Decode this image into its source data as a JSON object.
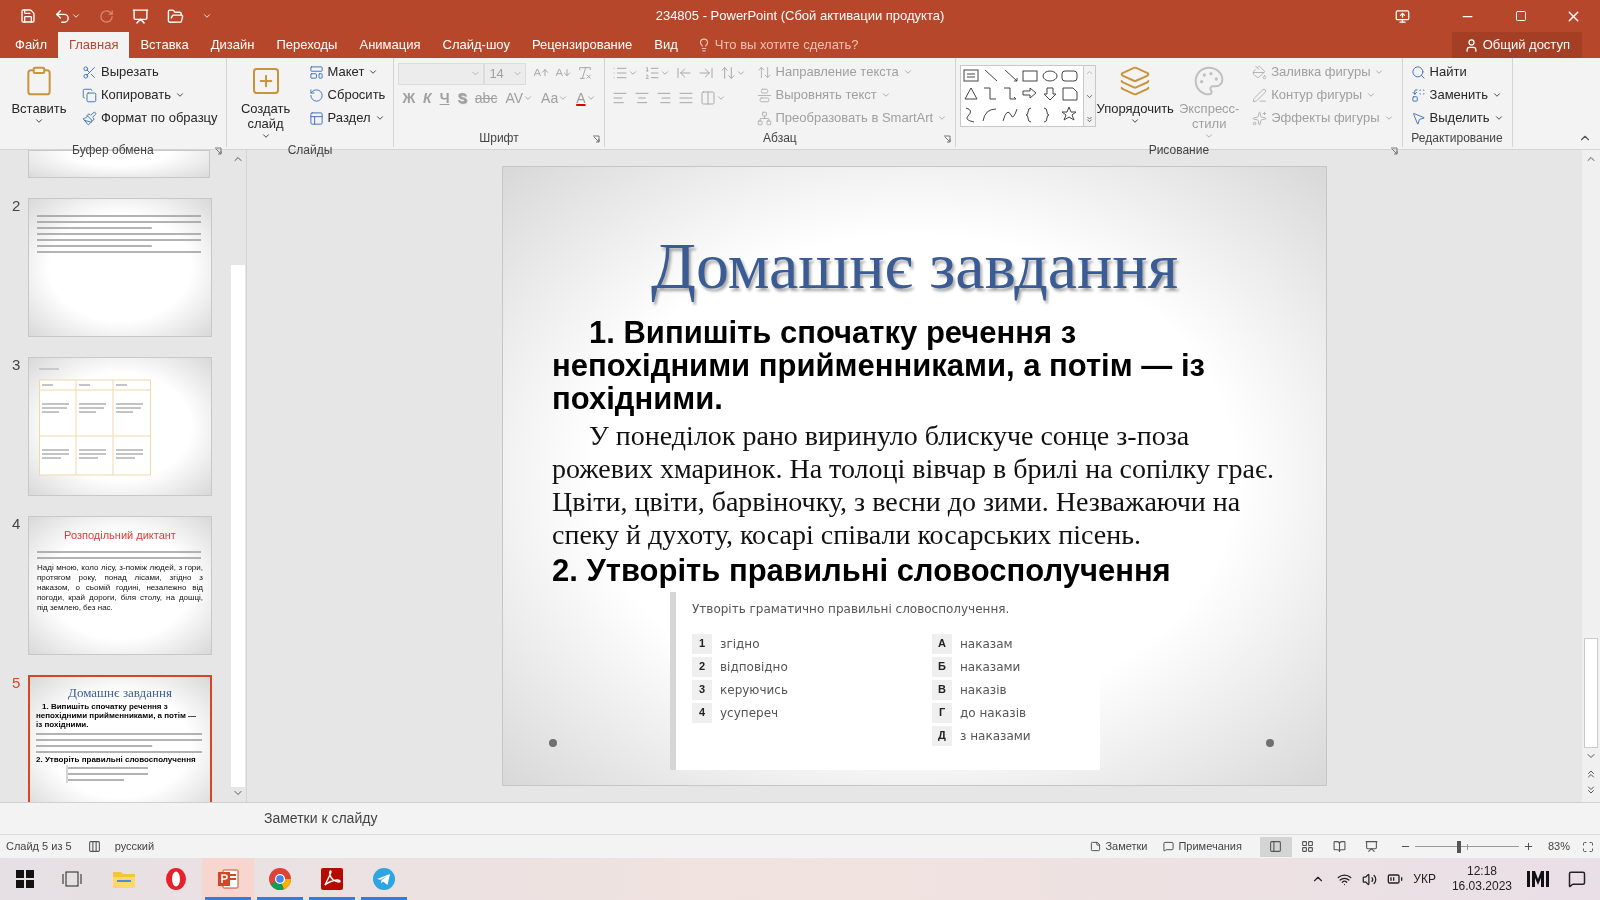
{
  "window": {
    "title": "234805 - PowerPoint (Сбой активации продукта)"
  },
  "menu_tabs": [
    {
      "label": "Файл",
      "selected": false
    },
    {
      "label": "Главная",
      "selected": true
    },
    {
      "label": "Вставка",
      "selected": false
    },
    {
      "label": "Дизайн",
      "selected": false
    },
    {
      "label": "Переходы",
      "selected": false
    },
    {
      "label": "Анимация",
      "selected": false
    },
    {
      "label": "Слайд-шоу",
      "selected": false
    },
    {
      "label": "Рецензирование",
      "selected": false
    },
    {
      "label": "Вид",
      "selected": false
    }
  ],
  "tell_me": {
    "placeholder": "Что вы хотите сделать?"
  },
  "share_button": "Общий доступ",
  "ribbon": {
    "groups": [
      {
        "title": "Буфер обмена",
        "launcher": true,
        "columns": [
          [
            [
              {
                "kind": "large",
                "label": "Вставить",
                "caret": true,
                "disabled": false
              }
            ]
          ],
          [
            [
              {
                "kind": "small",
                "label": "Вырезать",
                "caret": false,
                "disabled": false
              }
            ],
            [
              {
                "kind": "small",
                "label": "Копировать",
                "caret": true,
                "disabled": false
              }
            ],
            [
              {
                "kind": "small",
                "label": "Формат по образцу",
                "caret": false,
                "disabled": false
              }
            ]
          ]
        ]
      },
      {
        "title": "Слайды",
        "launcher": false,
        "columns": [
          [
            [
              {
                "kind": "large",
                "label": "Создать слайд",
                "caret": true,
                "disabled": false
              }
            ]
          ],
          [
            [
              {
                "kind": "small",
                "label": "Макет",
                "caret": true,
                "disabled": false
              }
            ],
            [
              {
                "kind": "small",
                "label": "Сбросить",
                "caret": false,
                "disabled": false
              }
            ],
            [
              {
                "kind": "small",
                "label": "Раздел",
                "caret": true,
                "disabled": false
              }
            ]
          ]
        ]
      },
      {
        "title": "Шрифт",
        "launcher": true,
        "columns": [
          [
            [
              {
                "kind": "font-box",
                "disabled": true
              },
              {
                "kind": "size-box",
                "value": "14",
                "disabled": true
              },
              {
                "kind": "icon",
                "caret": false,
                "disabled": true
              },
              {
                "kind": "icon",
                "caret": false,
                "disabled": true
              },
              {
                "kind": "icon",
                "caret": false,
                "disabled": true
              }
            ],
            [
              {
                "kind": "glyph",
                "label": "Ж",
                "caret": false,
                "disabled": true
              },
              {
                "kind": "glyph",
                "label": "К",
                "caret": false,
                "disabled": true
              },
              {
                "kind": "glyph",
                "label": "Ч",
                "caret": false,
                "disabled": true
              },
              {
                "kind": "glyph",
                "label": "S",
                "caret": false,
                "disabled": true
              },
              {
                "kind": "glyph",
                "label": "abc",
                "caret": false,
                "disabled": true
              },
              {
                "kind": "glyph",
                "label": "AV",
                "caret": true,
                "disabled": true
              },
              {
                "kind": "glyph",
                "label": "Aa",
                "caret": true,
                "disabled": true
              },
              {
                "kind": "glyph",
                "label": "A",
                "caret": true,
                "disabled": true
              }
            ]
          ]
        ]
      },
      {
        "title": "Абзац",
        "launcher": true,
        "columns": [
          [
            [
              {
                "kind": "icon",
                "caret": true,
                "disabled": true
              },
              {
                "kind": "icon",
                "caret": true,
                "disabled": true
              },
              {
                "kind": "icon",
                "caret": false,
                "disabled": true
              },
              {
                "kind": "icon",
                "caret": false,
                "disabled": true
              },
              {
                "kind": "icon",
                "caret": true,
                "disabled": true
              }
            ],
            [
              {
                "kind": "icon",
                "caret": false,
                "disabled": true
              },
              {
                "kind": "icon",
                "caret": false,
                "disabled": true
              },
              {
                "kind": "icon",
                "caret": false,
                "disabled": true
              },
              {
                "kind": "icon",
                "caret": false,
                "disabled": true
              },
              {
                "kind": "icon",
                "caret": true,
                "disabled": true
              }
            ]
          ],
          [
            [
              {
                "kind": "small",
                "label": "Направление текста",
                "caret": true,
                "disabled": true
              }
            ],
            [
              {
                "kind": "small",
                "label": "Выровнять текст",
                "caret": true,
                "disabled": true
              }
            ],
            [
              {
                "kind": "small",
                "label": "Преобразовать в SmartArt",
                "caret": true,
                "disabled": true
              }
            ]
          ]
        ]
      },
      {
        "title": "Рисование",
        "launcher": true,
        "columns": [
          [
            [
              {
                "kind": "gallery"
              }
            ]
          ],
          [
            [
              {
                "kind": "large",
                "label": "Упорядочить",
                "caret": true,
                "disabled": false
              }
            ]
          ],
          [
            [
              {
                "kind": "large",
                "label": "Экспресс-стили",
                "caret": true,
                "disabled": true
              }
            ]
          ],
          [
            [
              {
                "kind": "small",
                "label": "Заливка фигуры",
                "caret": true,
                "disabled": true
              }
            ],
            [
              {
                "kind": "small",
                "label": "Контур фигуры",
                "caret": true,
                "disabled": true
              }
            ],
            [
              {
                "kind": "small",
                "label": "Эффекты фигуры",
                "caret": true,
                "disabled": true
              }
            ]
          ]
        ]
      },
      {
        "title": "Редактирование",
        "launcher": false,
        "columns": [
          [
            [
              {
                "kind": "small",
                "label": "Найти",
                "caret": false,
                "disabled": false
              }
            ],
            [
              {
                "kind": "small",
                "label": "Заменить",
                "caret": true,
                "disabled": false
              }
            ],
            [
              {
                "kind": "small",
                "label": "Выделить",
                "caret": true,
                "disabled": false
              }
            ]
          ]
        ]
      }
    ]
  },
  "thumbnails": [
    {
      "kind": "partial",
      "selected": false
    },
    {
      "kind": "text",
      "number": "2",
      "selected": false
    },
    {
      "kind": "table",
      "number": "3",
      "selected": false
    },
    {
      "kind": "dictation",
      "number": "4",
      "selected": false,
      "title": "Розподільний диктант",
      "text": "Наді мною, коло лісу, з-поміж людей, з гори, протягом року, понад лісами, згідно з наказом, о сьомій годині, незалежно від погоди, край дороги, біля столу, на дошці, під землею, без нас."
    },
    {
      "kind": "homework",
      "number": "5",
      "selected": true,
      "title": "Домашнє завдання",
      "task_1": "1. Випишіть спочатку речення з непохідними прийменниками, а потім — із похідними.",
      "task_2": "2. Утворіть правильні словосполучення"
    }
  ],
  "slide": {
    "title": "Домашнє завдання",
    "task_1": "1. Випишіть спочатку речення з непохідними прийменниками, а потім — із похідними.",
    "paragraph": "У понеділок рано виринуло блискуче сонце з-поза рожевих хмаринок. На толоці вівчар в брилі на сопілку грає. Цвіти, цвіти, барвіночку, з весни до зими. Незважаючи на спеку й духоту, косарі співали косарських пісень.",
    "task_2": "2. Утворіть правильні словосполучення",
    "exercise": {
      "instruction": "Утворіть граматично правильні словосполучення.",
      "left": [
        {
          "key": "1",
          "text": "згідно"
        },
        {
          "key": "2",
          "text": "відповідно"
        },
        {
          "key": "3",
          "text": "керуючись"
        },
        {
          "key": "4",
          "text": "усупереч"
        }
      ],
      "right": [
        {
          "key": "А",
          "text": "наказам"
        },
        {
          "key": "Б",
          "text": "наказами"
        },
        {
          "key": "В",
          "text": "наказів"
        },
        {
          "key": "Г",
          "text": "до наказів"
        },
        {
          "key": "Д",
          "text": "з наказами"
        }
      ]
    }
  },
  "notes": {
    "placeholder": "Заметки к слайду"
  },
  "status_bar": {
    "slide_counter": "Слайд 5 из 5",
    "language": "русский",
    "notes_button": "Заметки",
    "comments_button": "Примечания",
    "views": [
      {
        "kind": "normal",
        "selected": true
      },
      {
        "kind": "sorter",
        "selected": false
      },
      {
        "kind": "reading",
        "selected": false
      },
      {
        "kind": "slideshow",
        "selected": false
      }
    ],
    "zoom": {
      "level": 0.42,
      "reading": "83%"
    }
  },
  "taskbar": {
    "apps": [
      {
        "kind": "task-view",
        "running": false,
        "active": false
      },
      {
        "kind": "explorer",
        "running": false,
        "active": false
      },
      {
        "kind": "opera",
        "running": false,
        "active": false
      },
      {
        "kind": "powerpoint",
        "running": true,
        "active": true
      },
      {
        "kind": "chrome",
        "running": true,
        "active": false
      },
      {
        "kind": "acrobat",
        "running": true,
        "active": false
      },
      {
        "kind": "telegram",
        "running": true,
        "active": false
      }
    ],
    "input_language": "УКР",
    "time": "12:18",
    "date": "16.03.2023"
  }
}
